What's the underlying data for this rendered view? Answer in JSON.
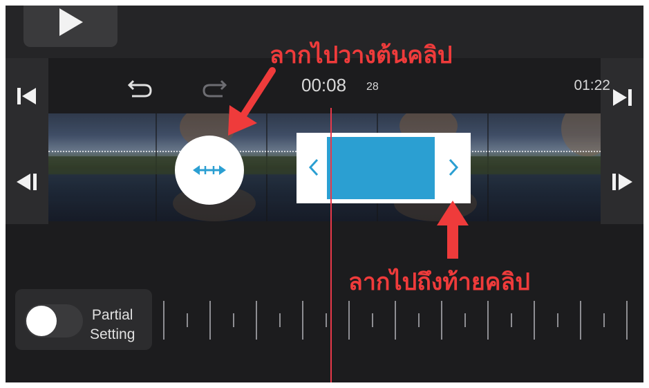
{
  "timeline": {
    "current_time": "00:08",
    "current_frame": "28",
    "total_time": "01:22"
  },
  "toolbar": {
    "play_icon": "play-icon",
    "undo_icon": "undo-icon",
    "redo_icon": "redo-icon",
    "skip_start_icon": "skip-to-start-icon",
    "skip_end_icon": "skip-to-end-icon",
    "prev_frame_icon": "previous-frame-icon",
    "next_frame_icon": "next-frame-icon"
  },
  "partial_setting": {
    "label_line1": "Partial",
    "label_line2": "Setting",
    "enabled": false
  },
  "annotations": {
    "top": "ลากไปวางต้นคลิป",
    "bottom": "ลากไปถึงท้ายคลิป"
  },
  "colors": {
    "annotation": "#ef3b3b",
    "playhead": "#e8394a",
    "selection": "#2b9fd2",
    "background": "#1c1c1e"
  }
}
